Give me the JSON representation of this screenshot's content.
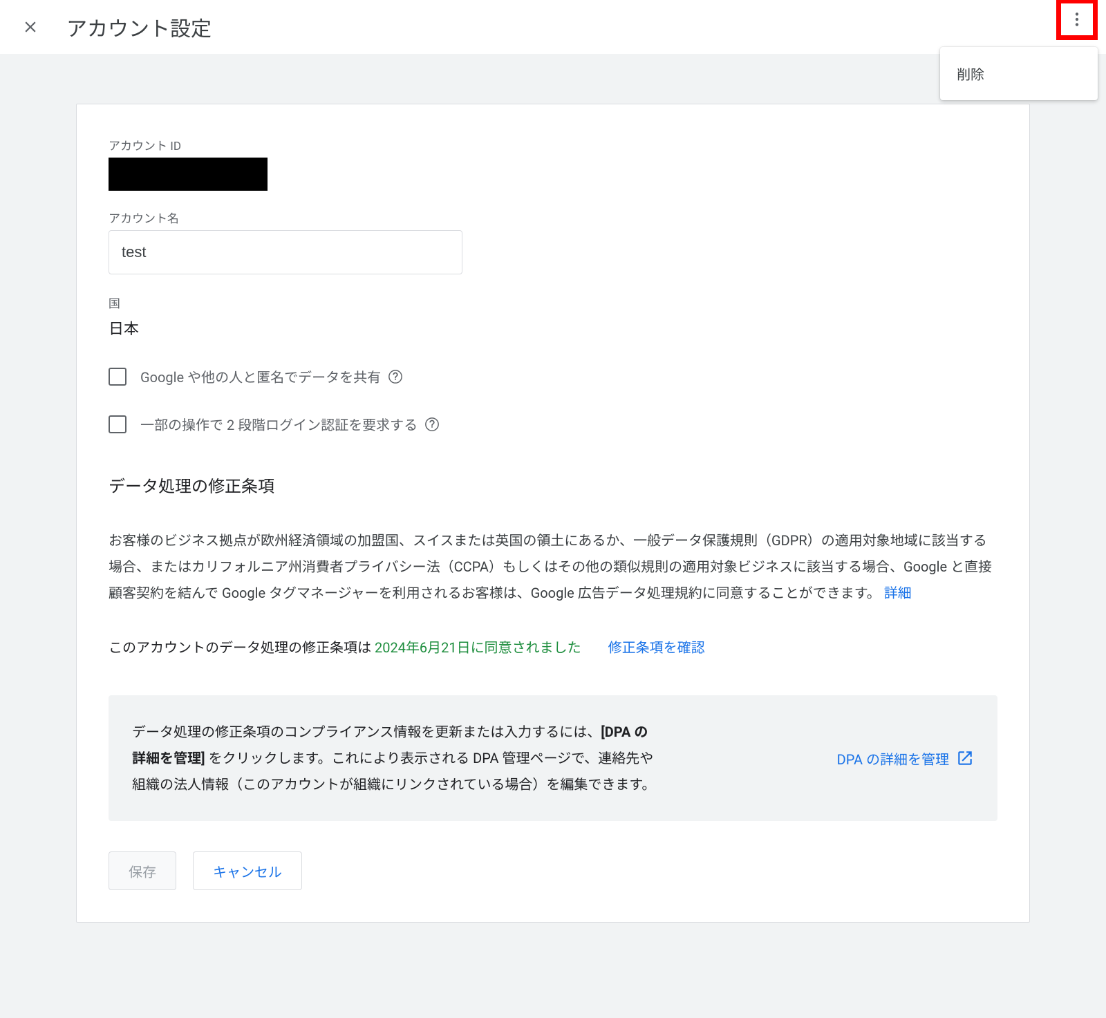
{
  "header": {
    "title": "アカウント設定",
    "menu": {
      "delete": "削除"
    }
  },
  "account": {
    "id_label": "アカウント ID",
    "name_label": "アカウント名",
    "name_value": "test",
    "country_label": "国",
    "country_value": "日本",
    "checkbox1": "Google や他の人と匿名でデータを共有",
    "checkbox2": "一部の操作で 2 段階ログイン認証を要求する"
  },
  "dpa": {
    "heading": "データ処理の修正条項",
    "body": "お客様のビジネス拠点が欧州経済領域の加盟国、スイスまたは英国の領土にあるか、一般データ保護規則（GDPR）の適用対象地域に該当する場合、またはカリフォルニア州消費者プライバシー法（CCPA）もしくはその他の類似規則の適用対象ビジネスに該当する場合、Google と直接顧客契約を結んで Google タグマネージャーを利用されるお客様は、Google 広告データ処理規約に同意することができます。",
    "details_link": "詳細",
    "agree_prefix": "このアカウントのデータ処理の修正条項は ",
    "agree_date": "2024年6月21日に同意されました",
    "confirm_link": "修正条項を確認",
    "info_pre": "データ処理の修正条項のコンプライアンス情報を更新または入力するには、",
    "info_bold": "[DPA の詳細を管理]",
    "info_post": " をクリックします。これにより表示される DPA 管理ページで、連絡先や組織の法人情報（このアカウントが組織にリンクされている場合）を編集できます。",
    "manage_link": "DPA の詳細を管理"
  },
  "buttons": {
    "save": "保存",
    "cancel": "キャンセル"
  }
}
